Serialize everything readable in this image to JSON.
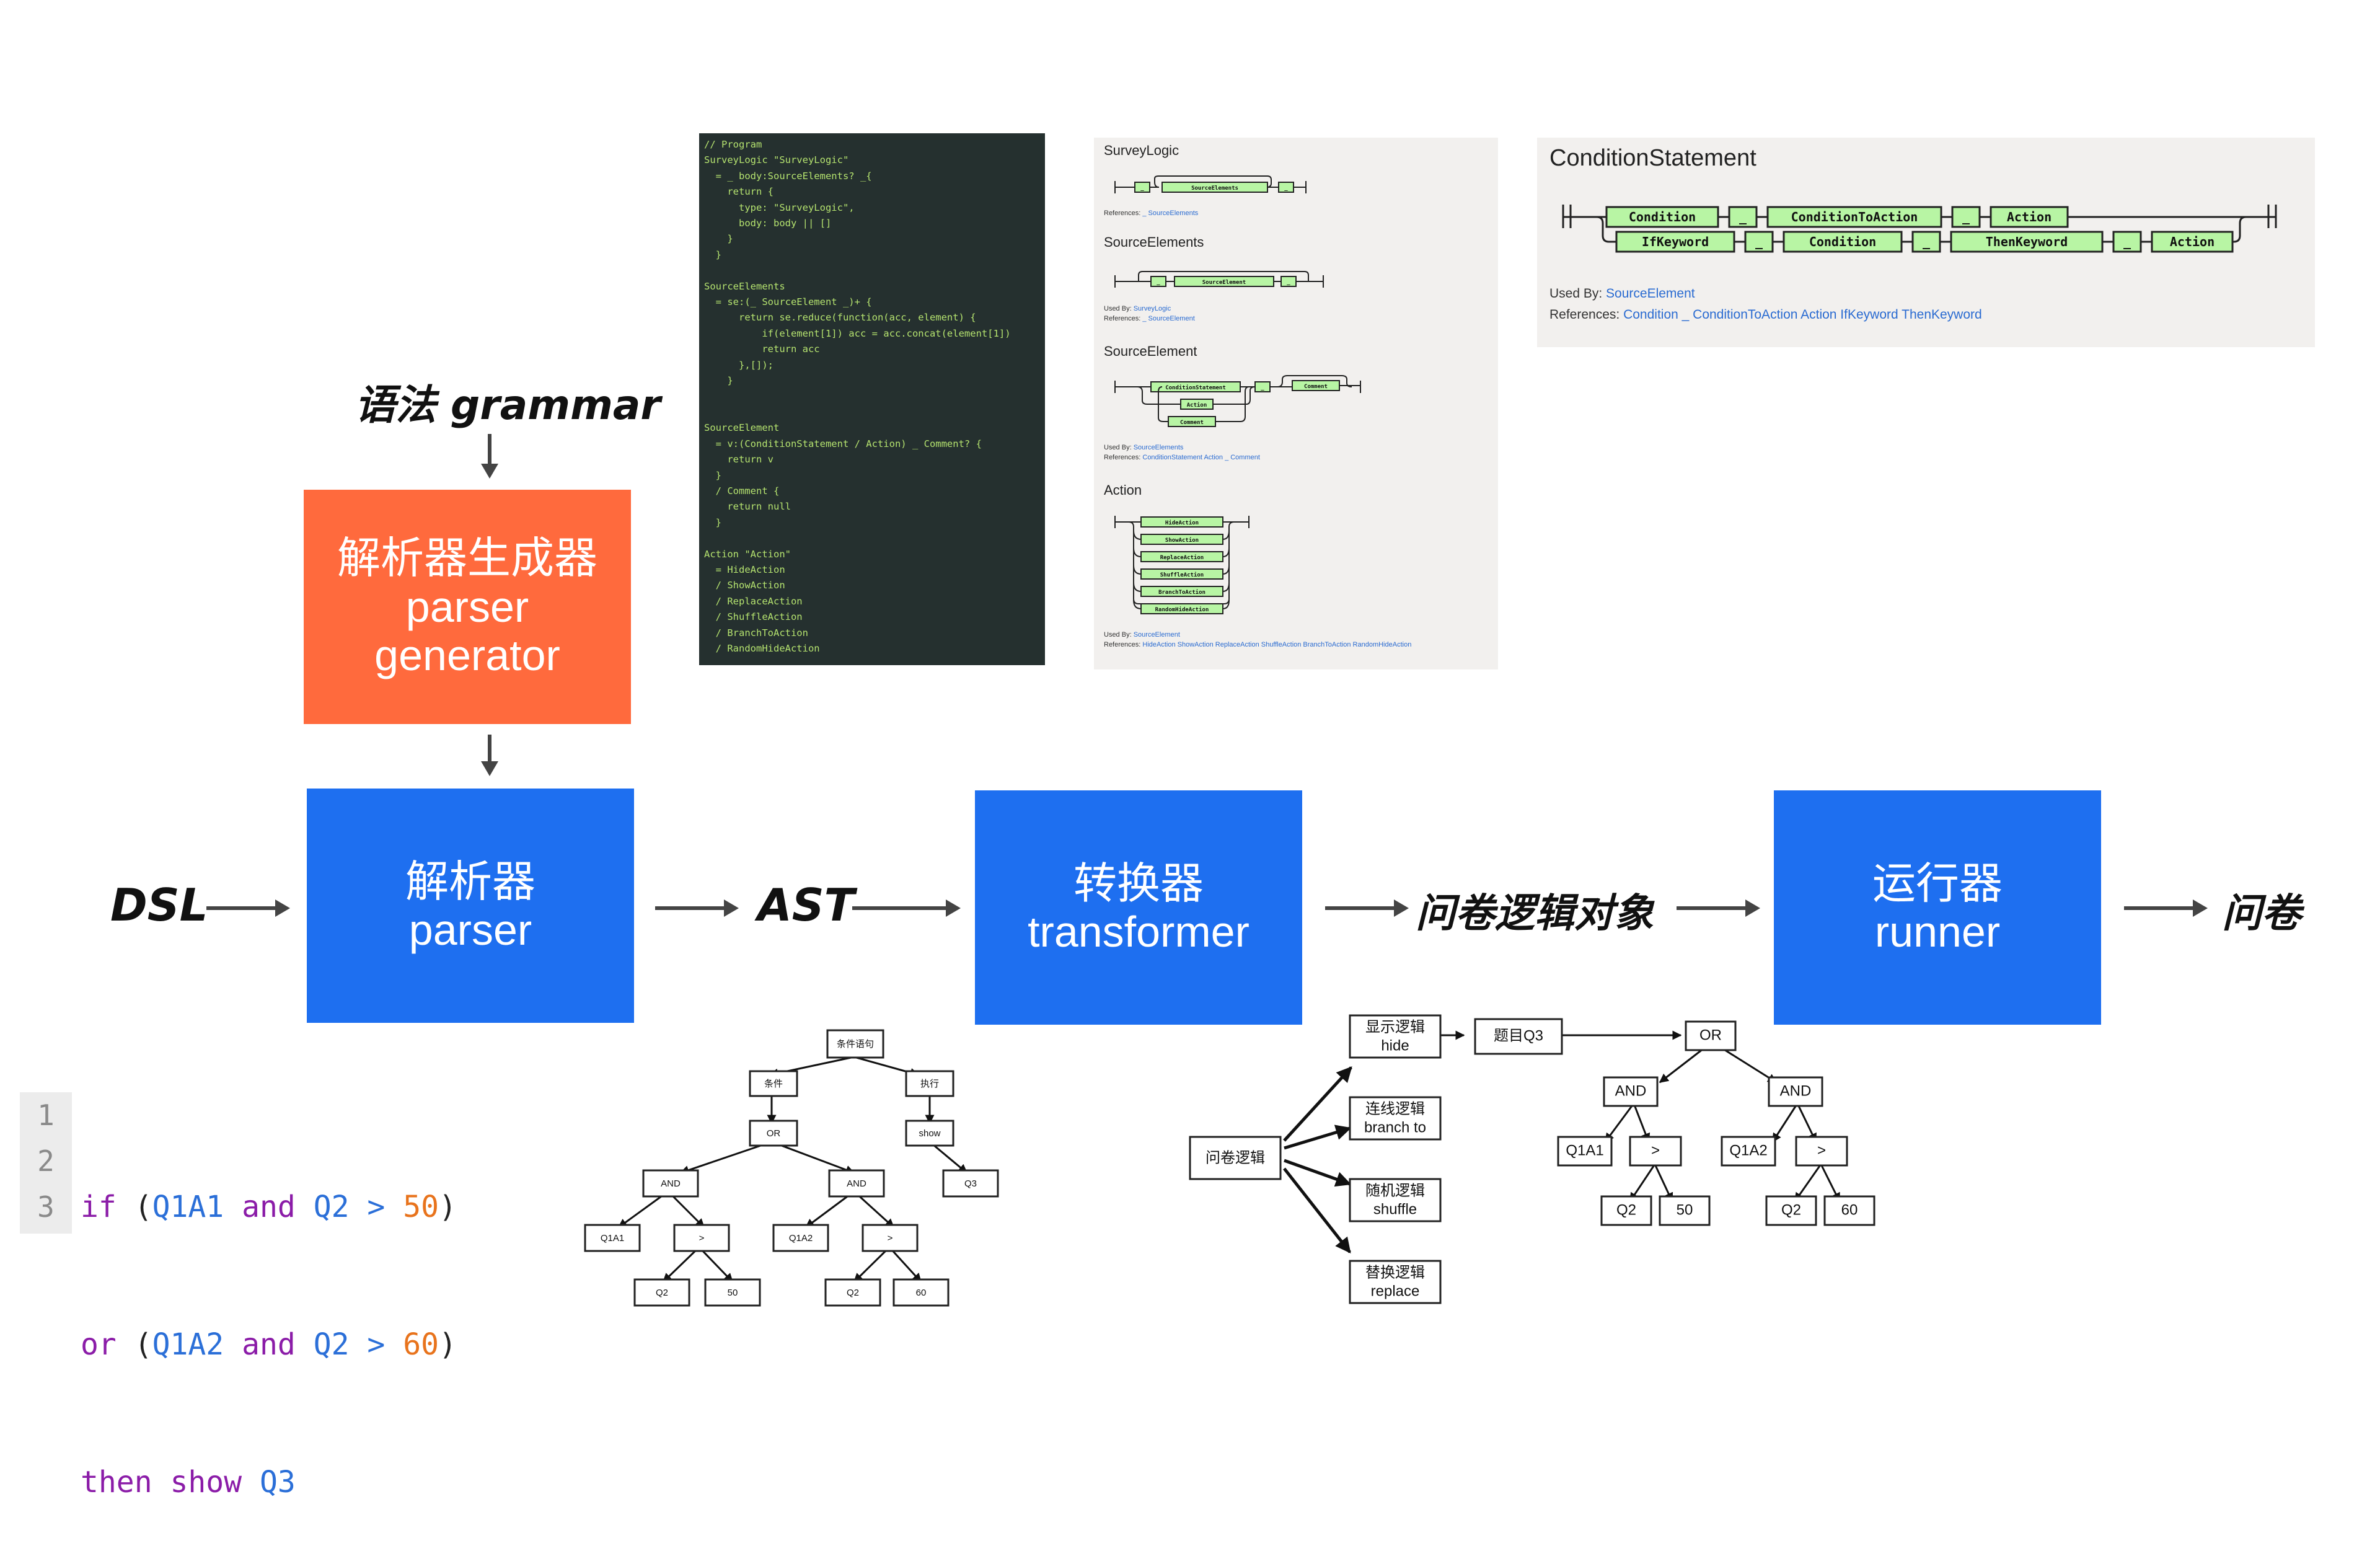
{
  "grammar_label": "语法 grammar",
  "parser_generator": {
    "line1": "解析器生成器",
    "line2": "parser",
    "line3": "generator"
  },
  "parser": {
    "line1": "解析器",
    "line2": "parser"
  },
  "transformer": {
    "line1": "转换器",
    "line2": "transformer"
  },
  "runner": {
    "line1": "运行器",
    "line2": "runner"
  },
  "flow_labels": {
    "dsl": "DSL",
    "ast": "AST",
    "logic_object": "问卷逻辑对象",
    "survey": "问卷"
  },
  "grammar_code": "// Program\nSurveyLogic \"SurveyLogic\"\n  = _ body:SourceElements? _{\n    return {\n      type: \"SurveyLogic\",\n      body: body || []\n    }\n  }\n\nSourceElements\n  = se:(_ SourceElement _)+ {\n      return se.reduce(function(acc, element) {\n          if(element[1]) acc = acc.concat(element[1])\n          return acc\n      },[]);\n    }\n\n\nSourceElement\n  = v:(ConditionStatement / Action) _ Comment? {\n    return v\n  }\n  / Comment {\n    return null\n  }\n\nAction \"Action\"\n  = HideAction\n  / ShowAction\n  / ReplaceAction\n  / ShuffleAction\n  / BranchToAction\n  / RandomHideAction",
  "railroad_small": {
    "surveylogic": {
      "title": "SurveyLogic",
      "node": "SourceElements",
      "references_label": "References:",
      "references": "_ SourceElements"
    },
    "sourceelements": {
      "title": "SourceElements",
      "node": "SourceElement",
      "used_by_label": "Used By:",
      "used_by": "SurveyLogic",
      "references_label": "References:",
      "references": "_ SourceElement"
    },
    "sourceelement": {
      "title": "SourceElement",
      "node1": "ConditionStatement",
      "node2": "Action",
      "node3": "Comment",
      "node4": "Comment",
      "used_by_label": "Used By:",
      "used_by": "SourceElements",
      "references_label": "References:",
      "references": "ConditionStatement Action _ Comment"
    },
    "action": {
      "title": "Action",
      "nodes": [
        "HideAction",
        "ShowAction",
        "ReplaceAction",
        "ShuffleAction",
        "BranchToAction",
        "RandomHideAction"
      ],
      "used_by_label": "Used By:",
      "used_by": "SourceElement",
      "references_label": "References:",
      "references": "HideAction ShowAction ReplaceAction ShuffleAction BranchToAction RandomHideAction"
    },
    "underscore": "_"
  },
  "condition_statement": {
    "title": "ConditionStatement",
    "row1": [
      "Condition",
      "_",
      "ConditionToAction",
      "_",
      "Action"
    ],
    "row2": [
      "IfKeyword",
      "_",
      "Condition",
      "_",
      "ThenKeyword",
      "_",
      "Action"
    ],
    "used_by_label": "Used By:",
    "used_by": "SourceElement",
    "references_label": "References:",
    "references": "Condition _ ConditionToAction Action IfKeyword ThenKeyword"
  },
  "dsl_code": {
    "line_numbers": [
      "1",
      "2",
      "3"
    ],
    "line1": {
      "kw": "if",
      "p1": " (",
      "id1": "Q1A1",
      "kw2": " and ",
      "id2": "Q2",
      "op": " > ",
      "num": "50",
      "p2": ")"
    },
    "line2": {
      "kw": "or",
      "p1": " (",
      "id1": "Q1A2",
      "kw2": " and ",
      "id2": "Q2",
      "op": " > ",
      "num": "60",
      "p2": ")"
    },
    "line3": {
      "kw": "then",
      "kw2": " show ",
      "id": "Q3"
    }
  },
  "ast_tree": {
    "root": "条件语句",
    "condition": "条件",
    "execute": "执行",
    "or": "OR",
    "show": "show",
    "q3": "Q3",
    "and1": "AND",
    "and2": "AND",
    "q1a1": "Q1A1",
    "gt1": ">",
    "q1a2": "Q1A2",
    "gt2": ">",
    "q2a": "Q2",
    "v50": "50",
    "q2b": "Q2",
    "v60": "60"
  },
  "logic_object": {
    "root": "问卷逻辑",
    "hide": {
      "cn": "显示逻辑",
      "en": "hide"
    },
    "branch": {
      "cn": "连线逻辑",
      "en": "branch to"
    },
    "shuffle": {
      "cn": "随机逻辑",
      "en": "shuffle"
    },
    "replace": {
      "cn": "替换逻辑",
      "en": "replace"
    },
    "q3": "题目Q3",
    "or": "OR",
    "and1": "AND",
    "and2": "AND",
    "q1a1": "Q1A1",
    "gt1": ">",
    "q1a2": "Q1A2",
    "gt2": ">",
    "q2a": "Q2",
    "v50": "50",
    "q2b": "Q2",
    "v60": "60"
  },
  "colors": {
    "blue": "#1e6ff0",
    "orange": "#ff6a3d",
    "rr_node": "#b8f5a4"
  }
}
